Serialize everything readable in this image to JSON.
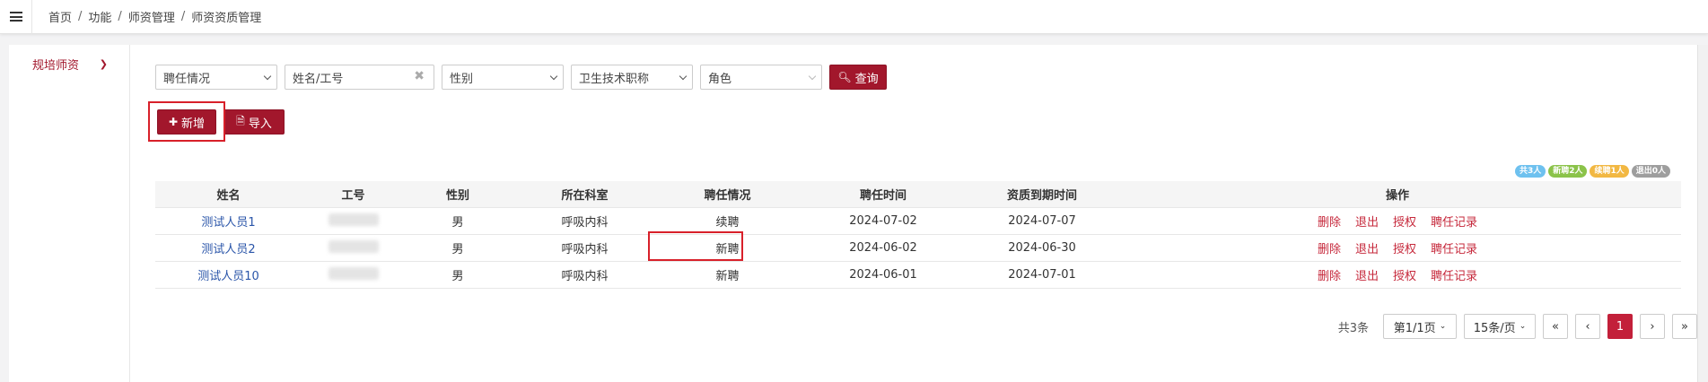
{
  "breadcrumb": [
    "首页",
    "功能",
    "师资管理",
    "师资资质管理"
  ],
  "breadcrumb_sep": "/",
  "sidebar": {
    "items": [
      {
        "label": "规培师资"
      }
    ]
  },
  "filters": {
    "employment_select": "聘任情况",
    "name_input_placeholder": "姓名/工号",
    "gender_select": "性别",
    "title_select": "卫生技术职称",
    "role_select": "角色",
    "query_label": "查询"
  },
  "actions": {
    "add_label": "新增",
    "import_label": "导入"
  },
  "badges": [
    {
      "text": "共3人",
      "color": "#6ec1ef"
    },
    {
      "text": "新聘2人",
      "color": "#8bc34a"
    },
    {
      "text": "续聘1人",
      "color": "#f2b843"
    },
    {
      "text": "退出0人",
      "color": "#9e9e9e"
    }
  ],
  "table": {
    "headers": [
      "姓名",
      "工号",
      "性别",
      "所在科室",
      "聘任情况",
      "聘任时间",
      "资质到期时间",
      "操作"
    ],
    "rows": [
      {
        "name": "测试人员1",
        "gender": "男",
        "dept": "呼吸内科",
        "status": "续聘",
        "hire_date": "2024-07-02",
        "expire_date": "2024-07-07"
      },
      {
        "name": "测试人员2",
        "gender": "男",
        "dept": "呼吸内科",
        "status": "新聘",
        "hire_date": "2024-06-02",
        "expire_date": "2024-06-30"
      },
      {
        "name": "测试人员10",
        "gender": "男",
        "dept": "呼吸内科",
        "status": "新聘",
        "hire_date": "2024-06-01",
        "expire_date": "2024-07-01"
      }
    ],
    "ops": [
      "删除",
      "退出",
      "授权",
      "聘任记录"
    ]
  },
  "pagination": {
    "total": "共3条",
    "page_select": "第1/1页",
    "size_select": "15条/页",
    "first": "«",
    "prev": "‹",
    "current": "1",
    "next": "›",
    "last": "»"
  },
  "colors": {
    "accent": "#a2172c",
    "link": "#2a55a9",
    "op": "#c6283b",
    "highlight": "#d8202a"
  }
}
